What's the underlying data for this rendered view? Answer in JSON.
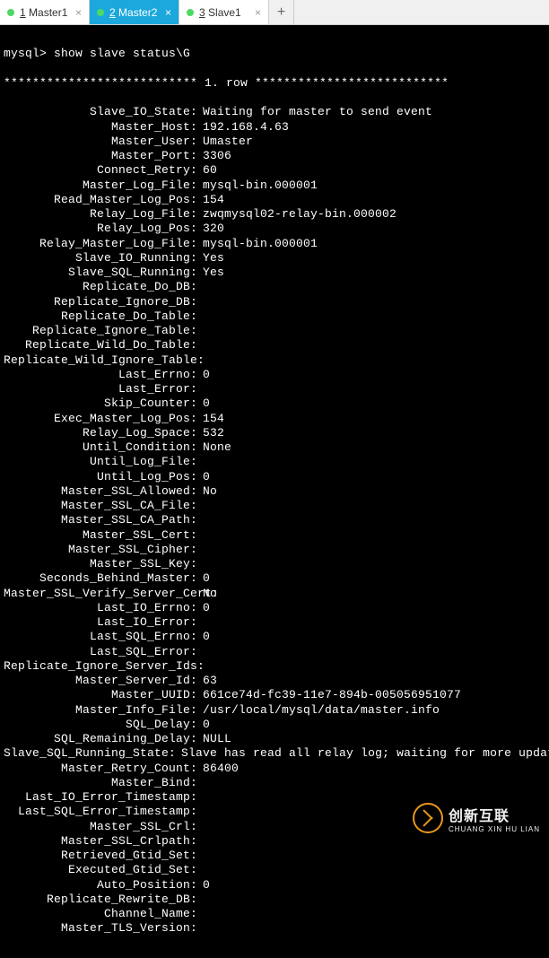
{
  "tabs": {
    "items": [
      {
        "num": "1",
        "name": "Master1",
        "active": false
      },
      {
        "num": "2",
        "name": "Master2",
        "active": true
      },
      {
        "num": "3",
        "name": "Slave1",
        "active": false
      }
    ]
  },
  "prompt": "mysql> show slave status\\G",
  "row_header": "*************************** 1. row ***************************",
  "fields": [
    {
      "k": "Slave_IO_State:",
      "v": "Waiting for master to send event"
    },
    {
      "k": "Master_Host:",
      "v": "192.168.4.63"
    },
    {
      "k": "Master_User:",
      "v": "Umaster"
    },
    {
      "k": "Master_Port:",
      "v": "3306"
    },
    {
      "k": "Connect_Retry:",
      "v": "60"
    },
    {
      "k": "Master_Log_File:",
      "v": "mysql-bin.000001"
    },
    {
      "k": "Read_Master_Log_Pos:",
      "v": "154"
    },
    {
      "k": "Relay_Log_File:",
      "v": "zwqmysql02-relay-bin.000002"
    },
    {
      "k": "Relay_Log_Pos:",
      "v": "320"
    },
    {
      "k": "Relay_Master_Log_File:",
      "v": "mysql-bin.000001"
    },
    {
      "k": "Slave_IO_Running:",
      "v": "Yes"
    },
    {
      "k": "Slave_SQL_Running:",
      "v": "Yes"
    },
    {
      "k": "Replicate_Do_DB:",
      "v": ""
    },
    {
      "k": "Replicate_Ignore_DB:",
      "v": ""
    },
    {
      "k": "Replicate_Do_Table:",
      "v": ""
    },
    {
      "k": "Replicate_Ignore_Table:",
      "v": ""
    },
    {
      "k": "Replicate_Wild_Do_Table:",
      "v": ""
    },
    {
      "k": "Replicate_Wild_Ignore_Table:",
      "v": ""
    },
    {
      "k": "Last_Errno:",
      "v": "0"
    },
    {
      "k": "Last_Error:",
      "v": ""
    },
    {
      "k": "Skip_Counter:",
      "v": "0"
    },
    {
      "k": "Exec_Master_Log_Pos:",
      "v": "154"
    },
    {
      "k": "Relay_Log_Space:",
      "v": "532"
    },
    {
      "k": "Until_Condition:",
      "v": "None"
    },
    {
      "k": "Until_Log_File:",
      "v": ""
    },
    {
      "k": "Until_Log_Pos:",
      "v": "0"
    },
    {
      "k": "Master_SSL_Allowed:",
      "v": "No"
    },
    {
      "k": "Master_SSL_CA_File:",
      "v": ""
    },
    {
      "k": "Master_SSL_CA_Path:",
      "v": ""
    },
    {
      "k": "Master_SSL_Cert:",
      "v": ""
    },
    {
      "k": "Master_SSL_Cipher:",
      "v": ""
    },
    {
      "k": "Master_SSL_Key:",
      "v": ""
    },
    {
      "k": "Seconds_Behind_Master:",
      "v": "0"
    },
    {
      "k": "Master_SSL_Verify_Server_Cert:",
      "v": "No"
    },
    {
      "k": "Last_IO_Errno:",
      "v": "0"
    },
    {
      "k": "Last_IO_Error:",
      "v": ""
    },
    {
      "k": "Last_SQL_Errno:",
      "v": "0"
    },
    {
      "k": "Last_SQL_Error:",
      "v": ""
    },
    {
      "k": "Replicate_Ignore_Server_Ids:",
      "v": ""
    },
    {
      "k": "Master_Server_Id:",
      "v": "63"
    },
    {
      "k": "Master_UUID:",
      "v": "661ce74d-fc39-11e7-894b-005056951077"
    },
    {
      "k": "Master_Info_File:",
      "v": "/usr/local/mysql/data/master.info"
    },
    {
      "k": "SQL_Delay:",
      "v": "0"
    },
    {
      "k": "SQL_Remaining_Delay:",
      "v": "NULL"
    },
    {
      "k": "Slave_SQL_Running_State:",
      "v": "Slave has read all relay log; waiting for more updates"
    },
    {
      "k": "Master_Retry_Count:",
      "v": "86400"
    },
    {
      "k": "Master_Bind:",
      "v": ""
    },
    {
      "k": "Last_IO_Error_Timestamp:",
      "v": ""
    },
    {
      "k": "Last_SQL_Error_Timestamp:",
      "v": ""
    },
    {
      "k": "Master_SSL_Crl:",
      "v": ""
    },
    {
      "k": "Master_SSL_Crlpath:",
      "v": ""
    },
    {
      "k": "Retrieved_Gtid_Set:",
      "v": ""
    },
    {
      "k": "Executed_Gtid_Set:",
      "v": ""
    },
    {
      "k": "Auto_Position:",
      "v": "0"
    },
    {
      "k": "Replicate_Rewrite_DB:",
      "v": ""
    },
    {
      "k": "Channel_Name:",
      "v": ""
    },
    {
      "k": "Master_TLS_Version:",
      "v": ""
    }
  ],
  "watermark": {
    "cn": "创新互联",
    "en": "CHUANG XIN HU LIAN"
  }
}
